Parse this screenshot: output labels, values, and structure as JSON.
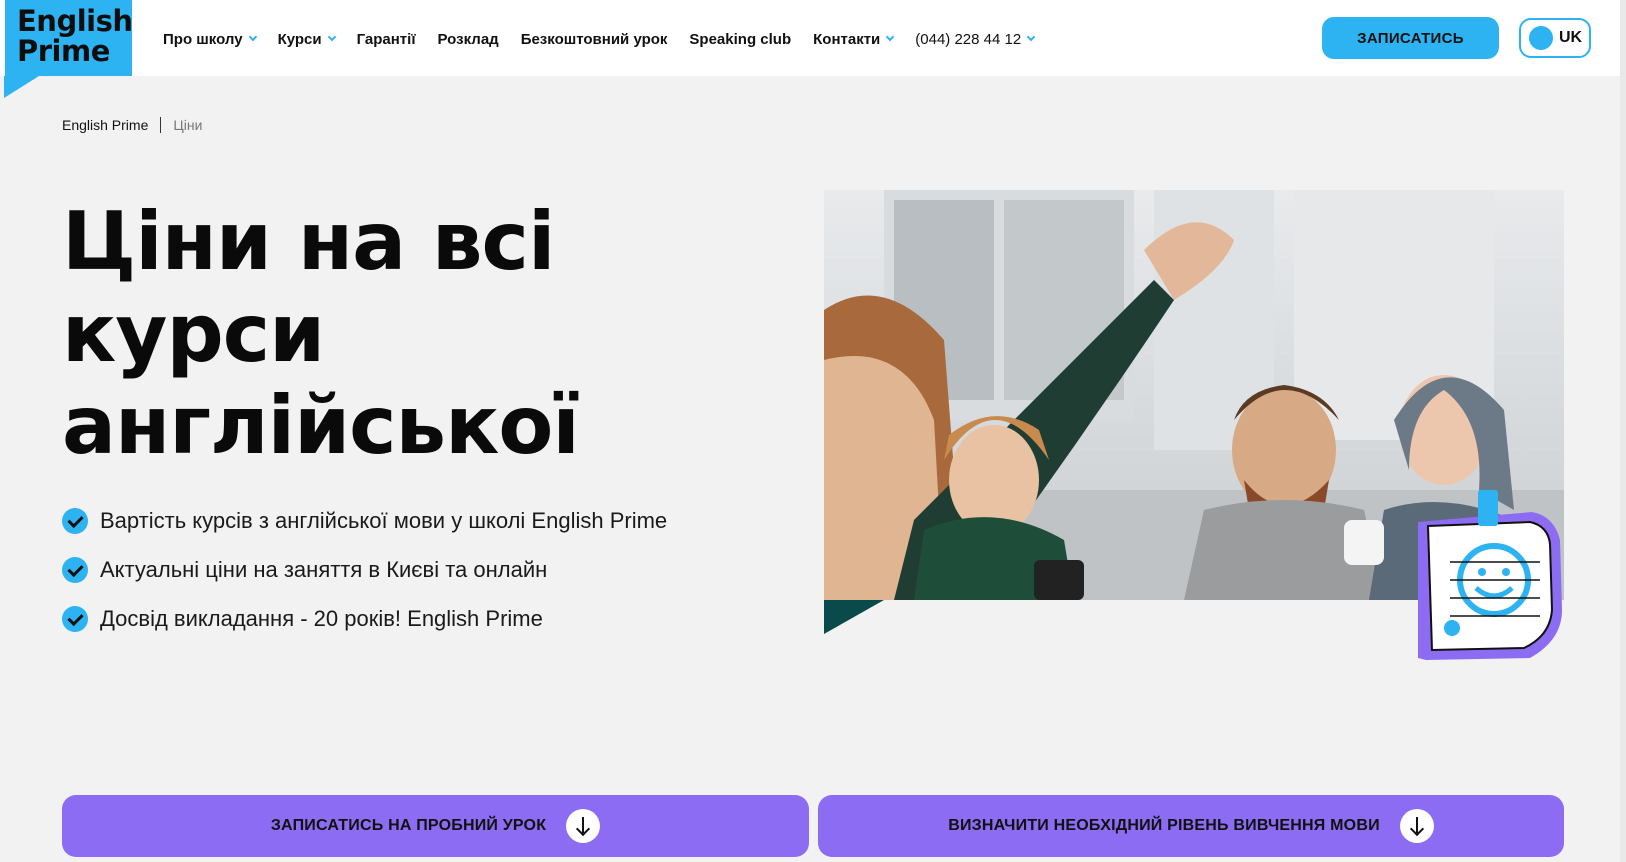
{
  "brand": {
    "logo_line1": "English",
    "logo_line2": "Prime",
    "accent": "#2db2f2",
    "purple": "#8c6cf2"
  },
  "nav": {
    "items": [
      {
        "label": "Про школу",
        "dropdown": true
      },
      {
        "label": "Курси",
        "dropdown": true
      },
      {
        "label": "Гарантії",
        "dropdown": false
      },
      {
        "label": "Розклад",
        "dropdown": false
      },
      {
        "label": "Безкоштовний урок",
        "dropdown": false
      },
      {
        "label": "Speaking club",
        "dropdown": false
      },
      {
        "label": "Контакти",
        "dropdown": true
      }
    ],
    "phone": "(044) 228 44 12",
    "cta": "ЗАПИСАТИСЬ",
    "lang": "UK"
  },
  "breadcrumb": {
    "home": "English Prime",
    "current": "Ціни"
  },
  "hero": {
    "title_line1": "Ціни на всі",
    "title_line2": "курси",
    "title_line3": "англійської",
    "points": [
      "Вартість курсів з англійської мови у школі English Prime",
      "Актуальні ціни на заняття в Києві та онлайн",
      "Досвід викладання - 20 років! English Prime"
    ]
  },
  "actions": {
    "trial_lesson": "ЗАПИСАТИСЬ НА ПРОБНИЙ УРОК",
    "level_test": "ВИЗНАЧИТИ НЕОБХІДНИЙ РІВЕНЬ ВИВЧЕННЯ МОВИ"
  }
}
